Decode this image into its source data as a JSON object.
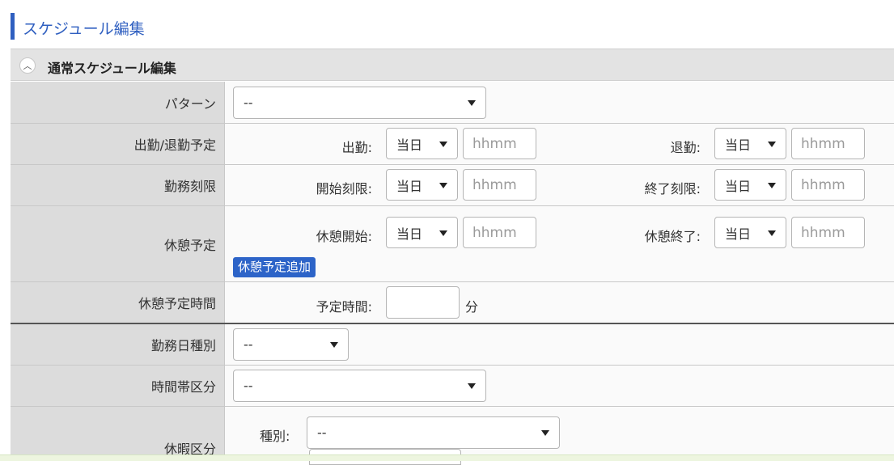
{
  "page": {
    "title": "スケジュール編集"
  },
  "section": {
    "title": "通常スケジュール編集",
    "toggle_icon": "chevron-up-icon"
  },
  "rows": {
    "pattern": {
      "label": "パターン",
      "select_value": "--"
    },
    "attendance": {
      "label": "出勤/退勤予定",
      "start_label": "出勤:",
      "start_day": "当日",
      "start_placeholder": "hhmm",
      "end_label": "退勤:",
      "end_day": "当日",
      "end_placeholder": "hhmm"
    },
    "work_limit": {
      "label": "勤務刻限",
      "start_label": "開始刻限:",
      "start_day": "当日",
      "start_placeholder": "hhmm",
      "end_label": "終了刻限:",
      "end_day": "当日",
      "end_placeholder": "hhmm"
    },
    "break_plan": {
      "label": "休憩予定",
      "start_label": "休憩開始:",
      "start_day": "当日",
      "start_placeholder": "hhmm",
      "end_label": "休憩終了:",
      "end_day": "当日",
      "end_placeholder": "hhmm",
      "add_button": "休憩予定追加"
    },
    "break_time": {
      "label": "休憩予定時間",
      "field_label": "予定時間:",
      "unit": "分",
      "value": ""
    },
    "workday_type": {
      "label": "勤務日種別",
      "select_value": "--"
    },
    "time_zone": {
      "label": "時間帯区分",
      "select_value": "--"
    },
    "leave": {
      "label": "休暇区分",
      "type_label": "種別:",
      "type_value": "--"
    }
  }
}
